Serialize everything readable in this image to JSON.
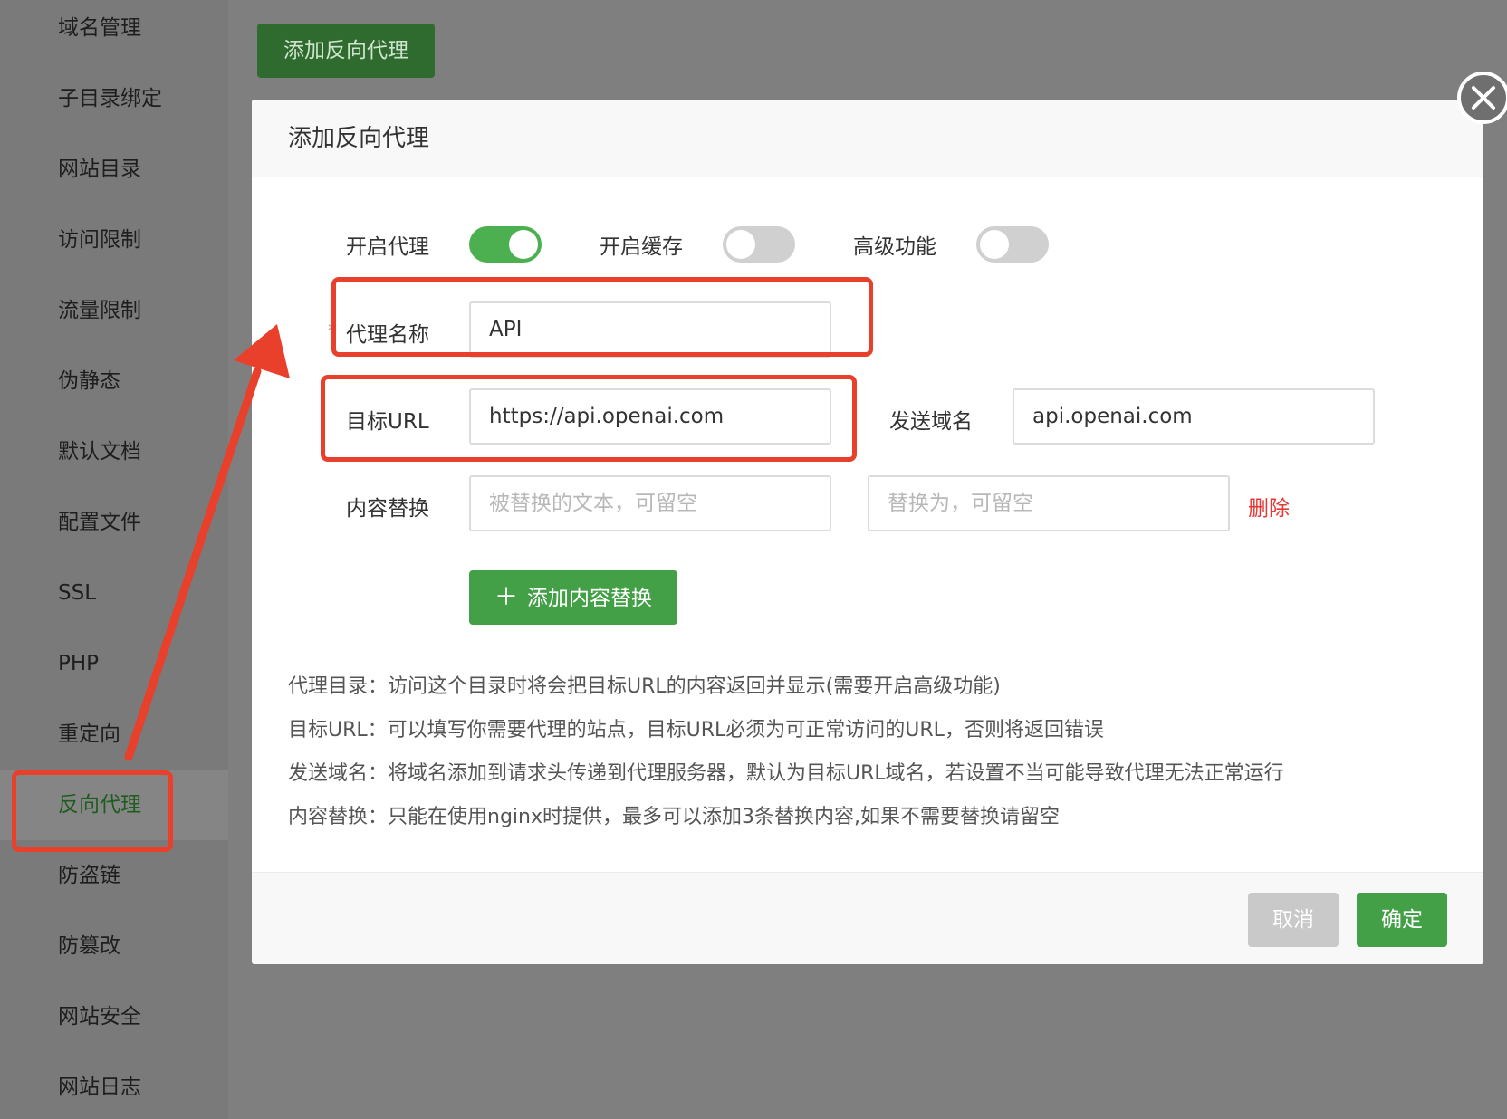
{
  "sidebar": {
    "items": [
      {
        "label": "域名管理"
      },
      {
        "label": "子目录绑定"
      },
      {
        "label": "网站目录"
      },
      {
        "label": "访问限制"
      },
      {
        "label": "流量限制"
      },
      {
        "label": "伪静态"
      },
      {
        "label": "默认文档"
      },
      {
        "label": "配置文件"
      },
      {
        "label": "SSL"
      },
      {
        "label": "PHP"
      },
      {
        "label": "重定向"
      },
      {
        "label": "反向代理",
        "active": true
      },
      {
        "label": "防盗链"
      },
      {
        "label": "防篡改"
      },
      {
        "label": "网站安全"
      },
      {
        "label": "网站日志"
      }
    ]
  },
  "top_button": {
    "label": "添加反向代理"
  },
  "dialog": {
    "title": "添加反向代理",
    "toggles": {
      "enable_proxy": {
        "label": "开启代理",
        "on": true
      },
      "enable_cache": {
        "label": "开启缓存",
        "on": false
      },
      "advanced": {
        "label": "高级功能",
        "on": false
      }
    },
    "proxy_name": {
      "label": "代理名称",
      "required_mark": "*",
      "value": "API"
    },
    "target_url": {
      "label": "目标URL",
      "value": "https://api.openai.com"
    },
    "send_domain": {
      "label": "发送域名",
      "value": "api.openai.com"
    },
    "content_replace": {
      "label": "内容替换",
      "from_placeholder": "被替换的文本，可留空",
      "to_placeholder": "替换为，可留空",
      "delete_label": "删除"
    },
    "add_replace_button": {
      "icon": "plus-icon",
      "label": "添加内容替换"
    },
    "help": [
      "代理目录：访问这个目录时将会把目标URL的内容返回并显示(需要开启高级功能)",
      "目标URL：可以填写你需要代理的站点，目标URL必须为可正常访问的URL，否则将返回错误",
      "发送域名：将域名添加到请求头传递到代理服务器，默认为目标URL域名，若设置不当可能导致代理无法正常运行",
      "内容替换：只能在使用nginx时提供，最多可以添加3条替换内容,如果不需要替换请留空"
    ],
    "footer": {
      "cancel_label": "取消",
      "ok_label": "确定"
    }
  },
  "colors": {
    "accent_green": "#43a047",
    "annotation_red": "#e8402a",
    "delete_red": "#e53935"
  }
}
